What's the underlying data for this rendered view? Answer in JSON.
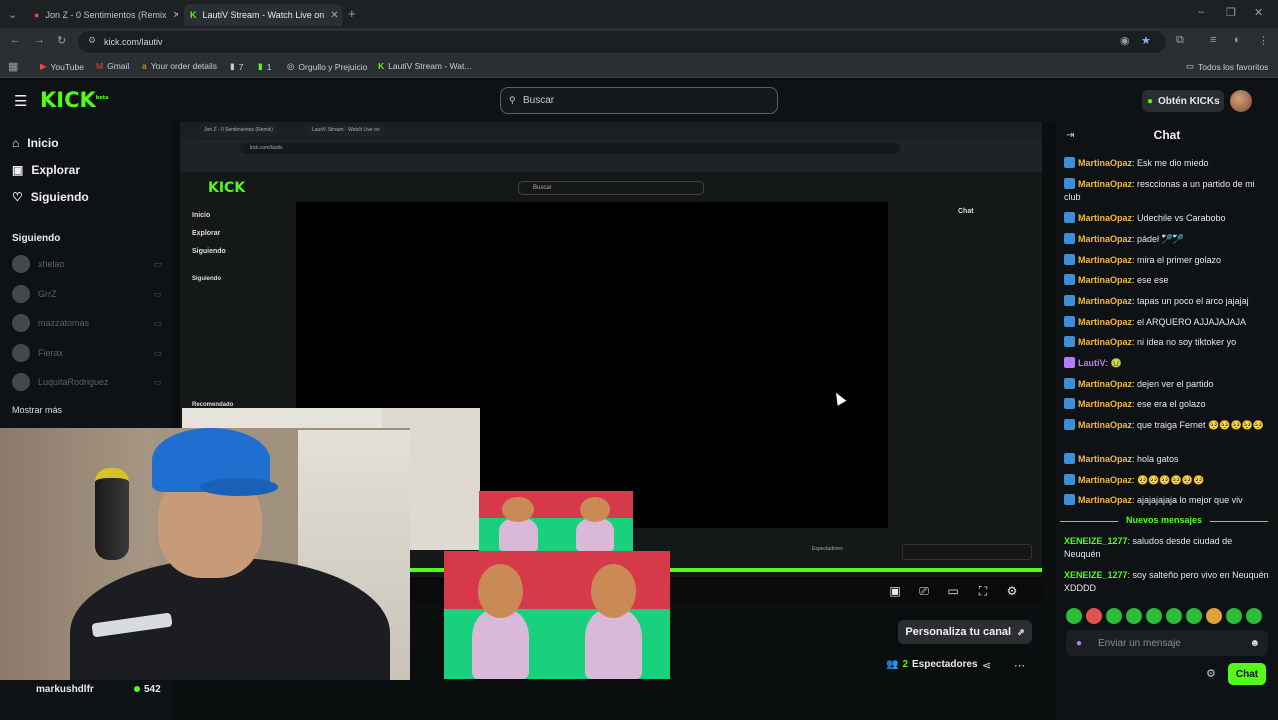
{
  "browser": {
    "tabs": [
      {
        "title": "Jon Z - 0 Sentimientos (Remix"
      },
      {
        "title": "LautiV Stream - Watch Live on"
      }
    ],
    "url": "kick.com/lautiv",
    "bookmarks": [
      "YouTube",
      "Gmail",
      "Your order details",
      "7",
      "1",
      "Orgullo y Prejuicio",
      "LautiV Stream - Wat..."
    ],
    "all_bookmarks": "Todos los favoritos"
  },
  "kick": {
    "logo": "KICK",
    "logo_beta": "beta",
    "search_placeholder": "Buscar",
    "get_kicks": "Obtén KICKs"
  },
  "sidebar": {
    "nav": [
      "Inicio",
      "Explorar",
      "Siguiendo"
    ],
    "following_title": "Siguiendo",
    "following": [
      "xhelao",
      "GrrZ",
      "mazzatomas",
      "Fierax",
      "LuquitaRodriguez"
    ],
    "show_more": "Mostrar más"
  },
  "inner_stream": {
    "tabs": [
      "Jon Z - 0 Sentimientos (Remix)",
      "LautiV Stream - Watch Live on"
    ],
    "url": "kick.com/lautiv",
    "logo": "KICK",
    "search": "Buscar",
    "nav": [
      "Inicio",
      "Explorar",
      "Siguiendo"
    ],
    "following_title": "Siguiendo",
    "recommended": "Recomendado",
    "chat_title": "Chat",
    "spectators": "Espectadores"
  },
  "stream": {
    "streamer": "markushdlfr",
    "viewer_count": "542",
    "customize_channel": "Personaliza tu canal",
    "spectators_count": "2",
    "spectators_label": "Espectadores"
  },
  "chat": {
    "title": "Chat",
    "messages": [
      {
        "user": "MartinaOpaz",
        "text": ": Esk me dio miedo",
        "color": "orange"
      },
      {
        "user": "MartinaOpaz",
        "text": ": resccionas a un partido de mi club",
        "color": "orange"
      },
      {
        "user": "MartinaOpaz",
        "text": ": Udechile vs Carabobo",
        "color": "orange"
      },
      {
        "user": "MartinaOpaz",
        "text": ": pádel 🏸🏸",
        "color": "orange"
      },
      {
        "user": "MartinaOpaz",
        "text": ": mira el primer golazo",
        "color": "orange"
      },
      {
        "user": "MartinaOpaz",
        "text": ": ese ese",
        "color": "orange"
      },
      {
        "user": "MartinaOpaz",
        "text": ": tapas un poco el arco jajajaj",
        "color": "orange"
      },
      {
        "user": "MartinaOpaz",
        "text": ": el ARQUERO AJJAJAJAJA",
        "color": "orange"
      },
      {
        "user": "MartinaOpaz",
        "text": ": ni idea no soy tiktoker yo",
        "color": "orange"
      },
      {
        "user": "LautiV",
        "text": ": 🤢",
        "color": "purple"
      },
      {
        "user": "MartinaOpaz",
        "text": ": dejen ver el partido",
        "color": "orange"
      },
      {
        "user": "MartinaOpaz",
        "text": ": ese era el golazo",
        "color": "orange"
      },
      {
        "user": "MartinaOpaz",
        "text": ": que traiga Fernet 🥺🥺🥺🥺🥺",
        "color": "orange"
      },
      {
        "user": "MartinaOpaz",
        "text": ": hola gatos",
        "color": "orange"
      },
      {
        "user": "MartinaOpaz",
        "text": ": 🥺🥺🥺🥺🥺🥺",
        "color": "orange"
      },
      {
        "user": "MartinaOpaz",
        "text": ": ajajajajaja lo mejor que viv",
        "color": "orange"
      }
    ],
    "new_messages_label": "Nuevos mensajes",
    "new_messages": [
      {
        "user": "XENEIZE_1277",
        "text": ": saludos desde ciudad de Neuquén"
      },
      {
        "user": "XENEIZE_1277",
        "text": ": soy salteño pero vivo en Neuquén XDDDD"
      }
    ],
    "input_placeholder": "Enviar un mensaje",
    "send_label": "Chat"
  },
  "colors": {
    "accent": "#53fc18",
    "chat_user": "#f5b83d",
    "bg": "#0b0e0f"
  }
}
